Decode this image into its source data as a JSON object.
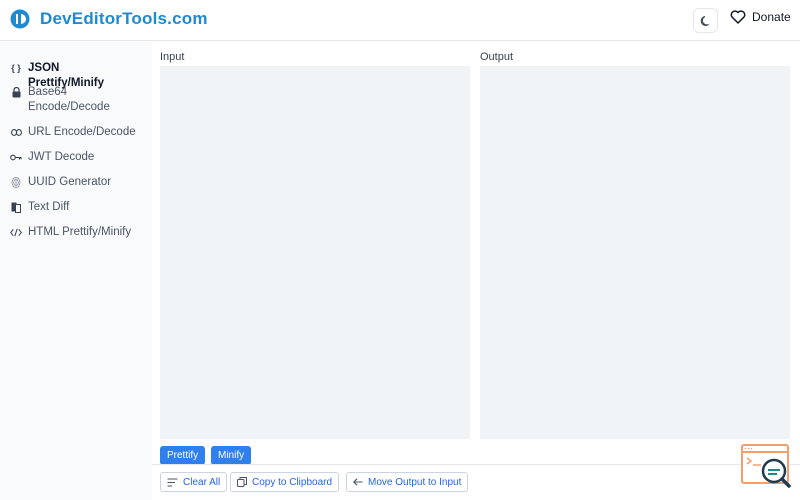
{
  "header": {
    "brand": "DevEditorTools.com",
    "donate_label": "Donate"
  },
  "sidebar": {
    "items": [
      {
        "label": "JSON Prettify/Minify",
        "icon": "braces-icon",
        "active": true
      },
      {
        "label": "Base64 Encode/Decode",
        "icon": "lock-icon"
      },
      {
        "label": "URL Encode/Decode",
        "icon": "link-icon"
      },
      {
        "label": "JWT Decode",
        "icon": "key-icon"
      },
      {
        "label": "UUID Generator",
        "icon": "fingerprint-icon"
      },
      {
        "label": "Text Diff",
        "icon": "compare-icon"
      },
      {
        "label": "HTML Prettify/Minify",
        "icon": "code-icon"
      }
    ]
  },
  "main": {
    "input_label": "Input",
    "output_label": "Output",
    "input_value": "",
    "output_value": "",
    "prettify_label": "Prettify",
    "minify_label": "Minify",
    "clear_label": "Clear All",
    "copy_label": "Copy to Clipboard",
    "move_label": "Move Output to Input"
  },
  "colors": {
    "brand": "#1d8ad1",
    "primary_button": "#2f80ed",
    "editor_bg": "#f1f4f7",
    "widget_accent": "#f59e6b"
  }
}
